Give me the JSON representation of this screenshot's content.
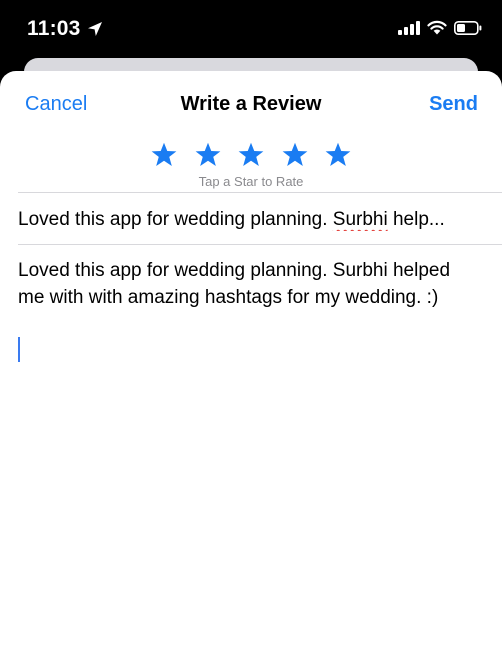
{
  "status_bar": {
    "time": "11:03",
    "icons": [
      "location-arrow-icon",
      "cellular-signal-icon",
      "wifi-icon",
      "battery-icon"
    ]
  },
  "nav": {
    "cancel_label": "Cancel",
    "title": "Write a Review",
    "send_label": "Send"
  },
  "rating": {
    "star_count": 5,
    "star_icon": "star-icon",
    "star_color": "#1a7cf2",
    "hint": "Tap a Star to Rate"
  },
  "review": {
    "title_before": "Loved this app for wedding planning. ",
    "title_misspelled": "Surbhi",
    "title_after": " help...",
    "body": "Loved this app for wedding planning. Surbhi helped me with with amazing hashtags for my wedding. :)"
  },
  "colors": {
    "accent": "#1a7cf2",
    "spellcheck": "#e0302a",
    "cursor": "#3a7bf0"
  }
}
